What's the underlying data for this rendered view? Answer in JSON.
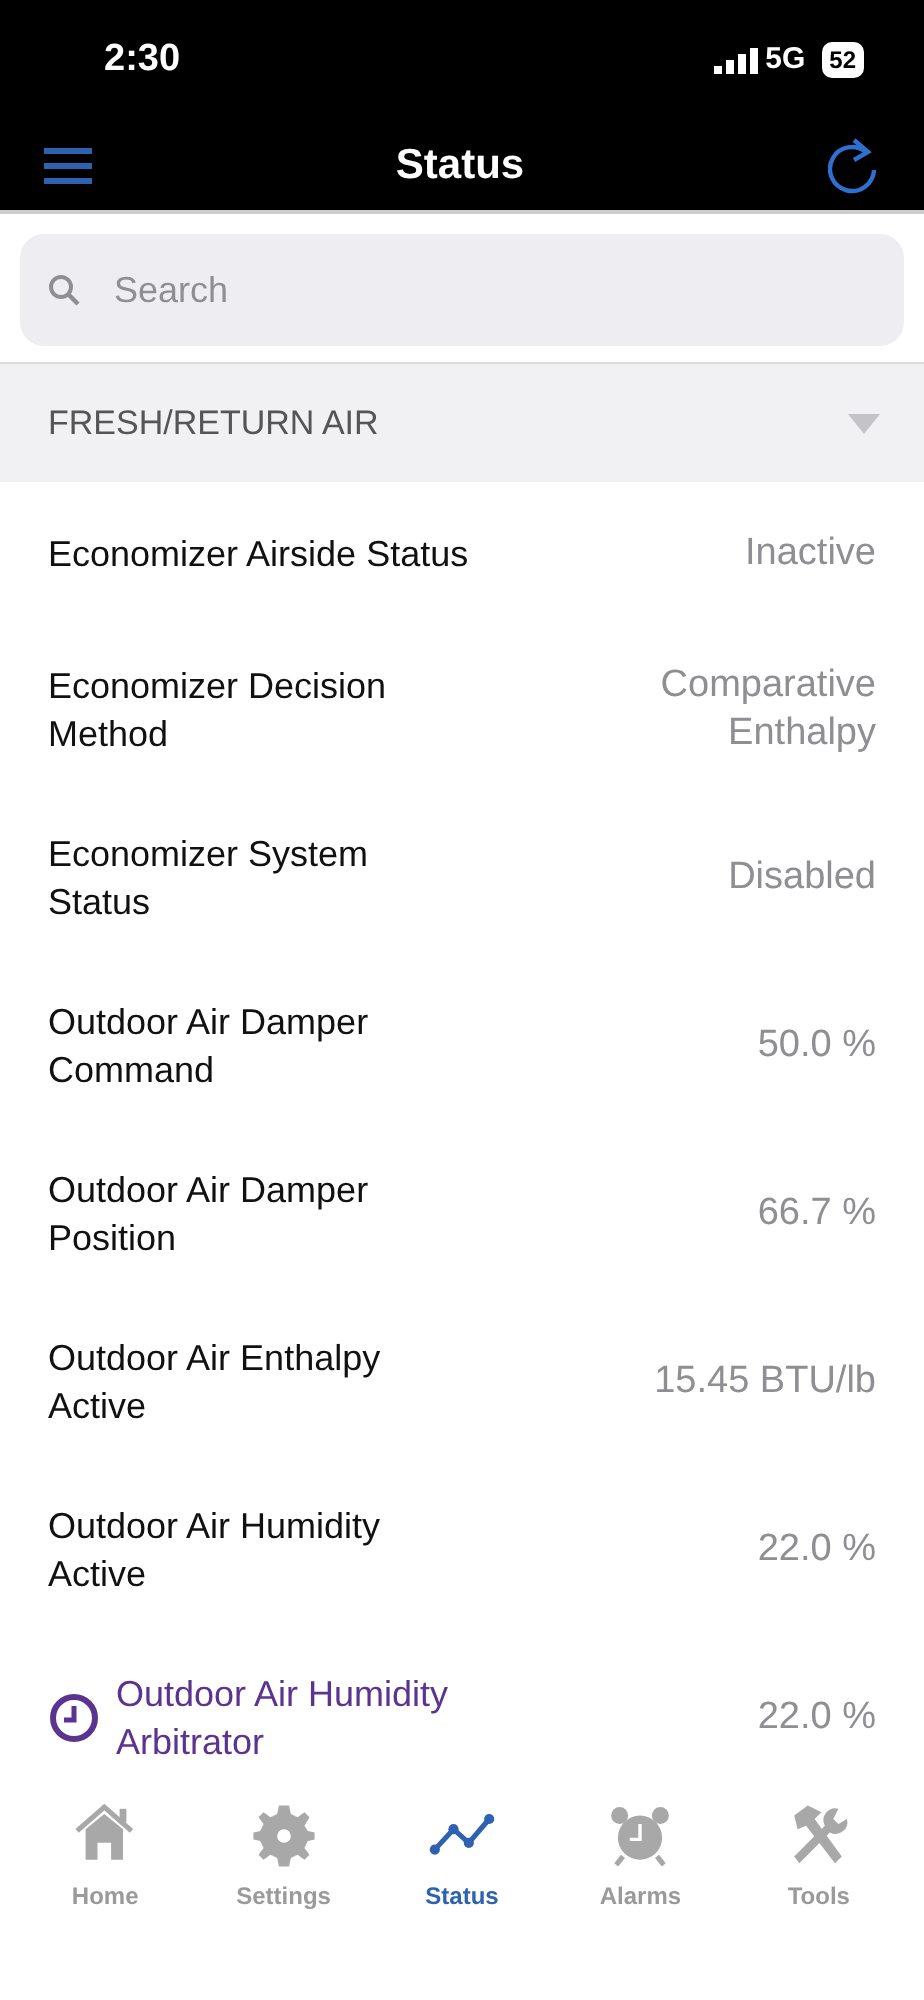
{
  "status_bar": {
    "time": "2:30",
    "network": "5G",
    "battery": "52"
  },
  "header": {
    "title": "Status"
  },
  "search": {
    "placeholder": "Search"
  },
  "section": {
    "title": "FRESH/RETURN AIR",
    "expanded": true
  },
  "rows": [
    {
      "kind": "plain",
      "label": "Economizer Airside Status",
      "value": "Inactive"
    },
    {
      "kind": "plain",
      "label": "Economizer Decision Method",
      "value": "Comparative Enthalpy"
    },
    {
      "kind": "plain",
      "label": "Economizer System Status",
      "value": "Disabled"
    },
    {
      "kind": "plain",
      "label": "Outdoor Air Damper Command",
      "value": "50.0 %"
    },
    {
      "kind": "plain",
      "label": "Outdoor Air Damper Position",
      "value": "66.7 %"
    },
    {
      "kind": "plain",
      "label": "Outdoor Air Enthalpy Active",
      "value": "15.45 BTU/lb"
    },
    {
      "kind": "plain",
      "label": "Outdoor Air Humidity Active",
      "value": "22.0 %"
    },
    {
      "kind": "override",
      "label": "Outdoor Air Humidity Arbitrator",
      "value": "22.0 %"
    }
  ],
  "tabs": [
    {
      "kind": "home",
      "label": "Home",
      "selected": false
    },
    {
      "kind": "gear",
      "label": "Settings",
      "selected": false
    },
    {
      "kind": "chart",
      "label": "Status",
      "selected": true
    },
    {
      "kind": "alarm",
      "label": "Alarms",
      "selected": false
    },
    {
      "kind": "tools",
      "label": "Tools",
      "selected": false
    }
  ]
}
